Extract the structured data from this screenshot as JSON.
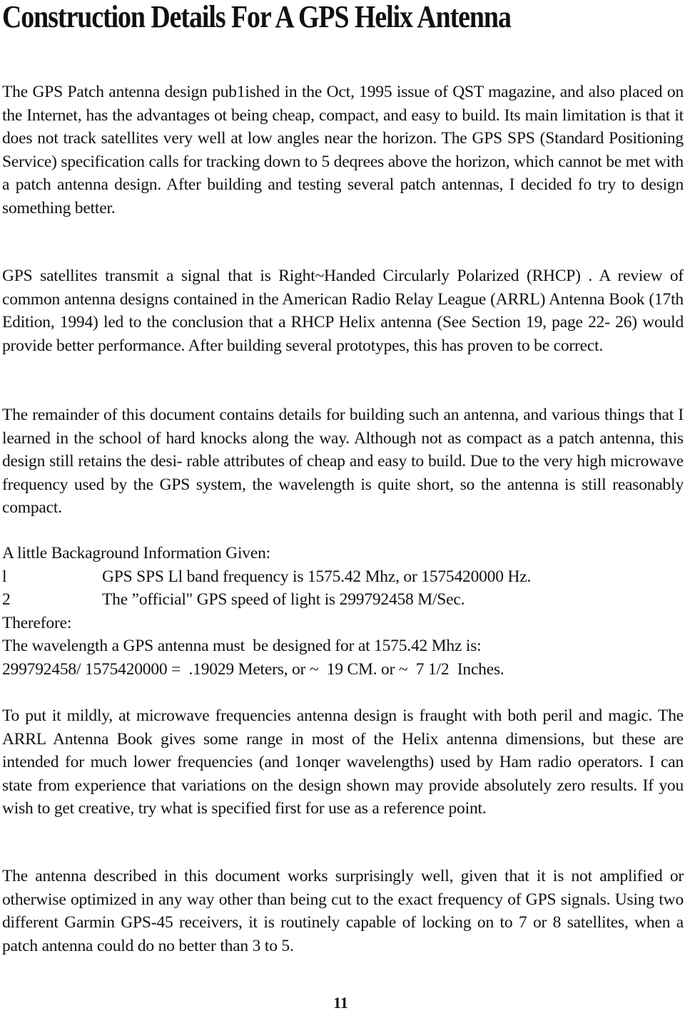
{
  "document": {
    "title": "Construction Details For A GPS Helix Antenna",
    "paragraphs": [
      "The GPS Patch antenna design pub1ished in the Oct, 1995 issue of QST magazine, and also placed on the Internet, has the advantages ot being cheap, compact, and easy to build. Its main limitation is that it does not track satellites very well at low angles near the horizon. The GPS SPS (Standard Positioning Service) specification calls for tracking down to 5 deqrees above the horizon, which cannot be met with a patch antenna design. After building and testing several patch antennas, I decided fo try to design something better.",
      "GPS satellites transmit a signal that is Right~Handed Circularly Polarized (RHCP) . A review of common antenna designs contained in the American Radio Relay League (ARRL) Antenna Book (17th Edition, 1994) led to the conclusion that a RHCP Helix antenna (See Section 19, page 22- 26) would provide better performance. After building several prototypes, this has proven to be correct.",
      "The remainder of this document contains details for building such an antenna, and various things that I learned in the school of hard knocks along the way. Although not as compact as a patch antenna, this design still retains the desi- rable attributes of cheap and easy to build. Due to the very high microwave frequency used by the GPS system, the wavelength is quite short, so the antenna is still reasonably compact.",
      "To put it mildly, at microwave frequencies antenna design is fraught with both peril and magic. The ARRL Antenna Book gives some range in most of the Helix antenna dimensions, but these are intended for much lower frequencies (and 1onqer wavelengths) used by Ham radio operators. I can state from experience that variations on the design shown may provide absolutely zero results. If you wish to get creative, try what is specified first for use as a reference point.",
      "The antenna described in this document works surprisingly well, given that it is not amplified or otherwise optimized in any way other than being cut to the exact frequency of GPS signals. Using two different Garmin GPS-45 receivers, it is routinely capable of locking on to 7 or 8 satellites, when a patch antenna could do no better than 3 to 5."
    ],
    "background": {
      "heading": "A little Backaground Information Given:",
      "items": [
        {
          "number": "l",
          "text": "GPS SPS Ll band frequency is 1575.42 Mhz, or 1575420000 Hz."
        },
        {
          "number": "2",
          "text": "The ”official\" GPS speed of light is 299792458 M/Sec."
        }
      ],
      "therefore": "Therefore:",
      "wavelength_statement": "The wavelength a GPS antenna must  be designed for at 1575.42 Mhz is:",
      "calculation": "299792458/ 1575420000 =  .19029 Meters, or ~  19 CM. or ~  7 1/2  Inches."
    },
    "page_number": "11"
  }
}
